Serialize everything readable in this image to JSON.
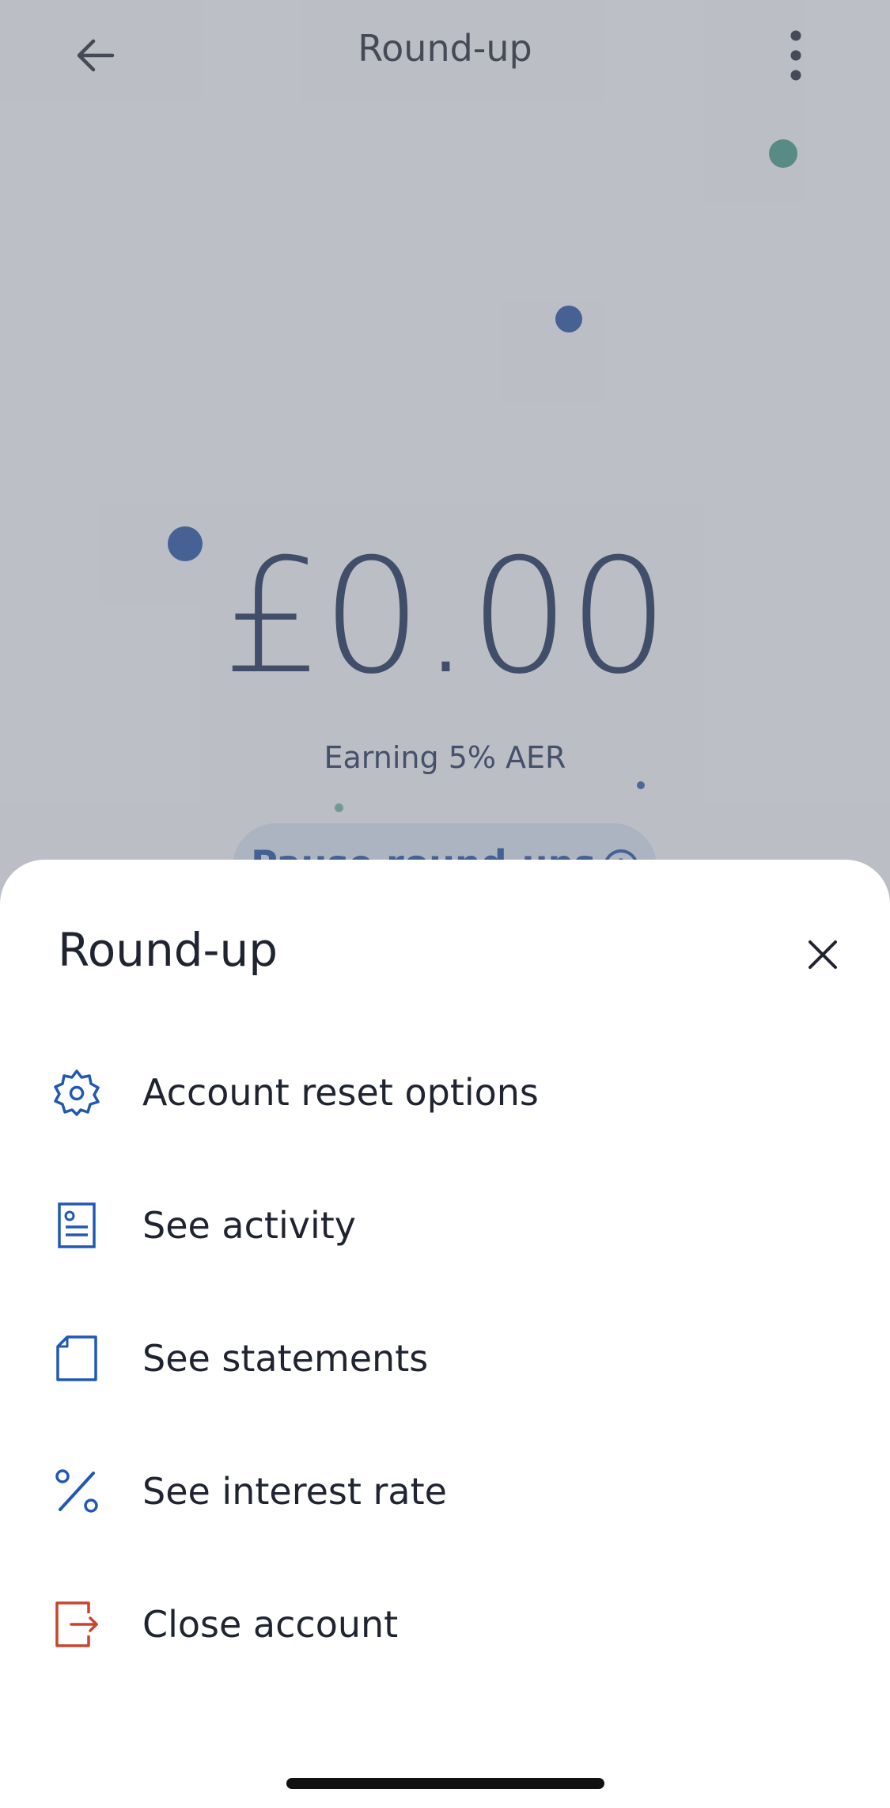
{
  "header": {
    "title": "Round-up"
  },
  "balance": {
    "amount": "£0.00",
    "earning": "Earning 5% AER"
  },
  "pause_button": {
    "label": "Pause round-ups",
    "info": "i"
  },
  "sheet": {
    "title": "Round-up",
    "items": [
      {
        "label": "Account reset options",
        "icon": "gear-icon"
      },
      {
        "label": "See activity",
        "icon": "document-icon"
      },
      {
        "label": "See statements",
        "icon": "page-icon"
      },
      {
        "label": "See interest rate",
        "icon": "percent-icon"
      },
      {
        "label": "Close account",
        "icon": "exit-icon"
      }
    ]
  },
  "colors": {
    "accent": "#2158b3",
    "danger": "#c8442f",
    "balance": "#142a54",
    "dot_green": "#4a9a8a",
    "dot_blue": "#1e4fa0"
  }
}
